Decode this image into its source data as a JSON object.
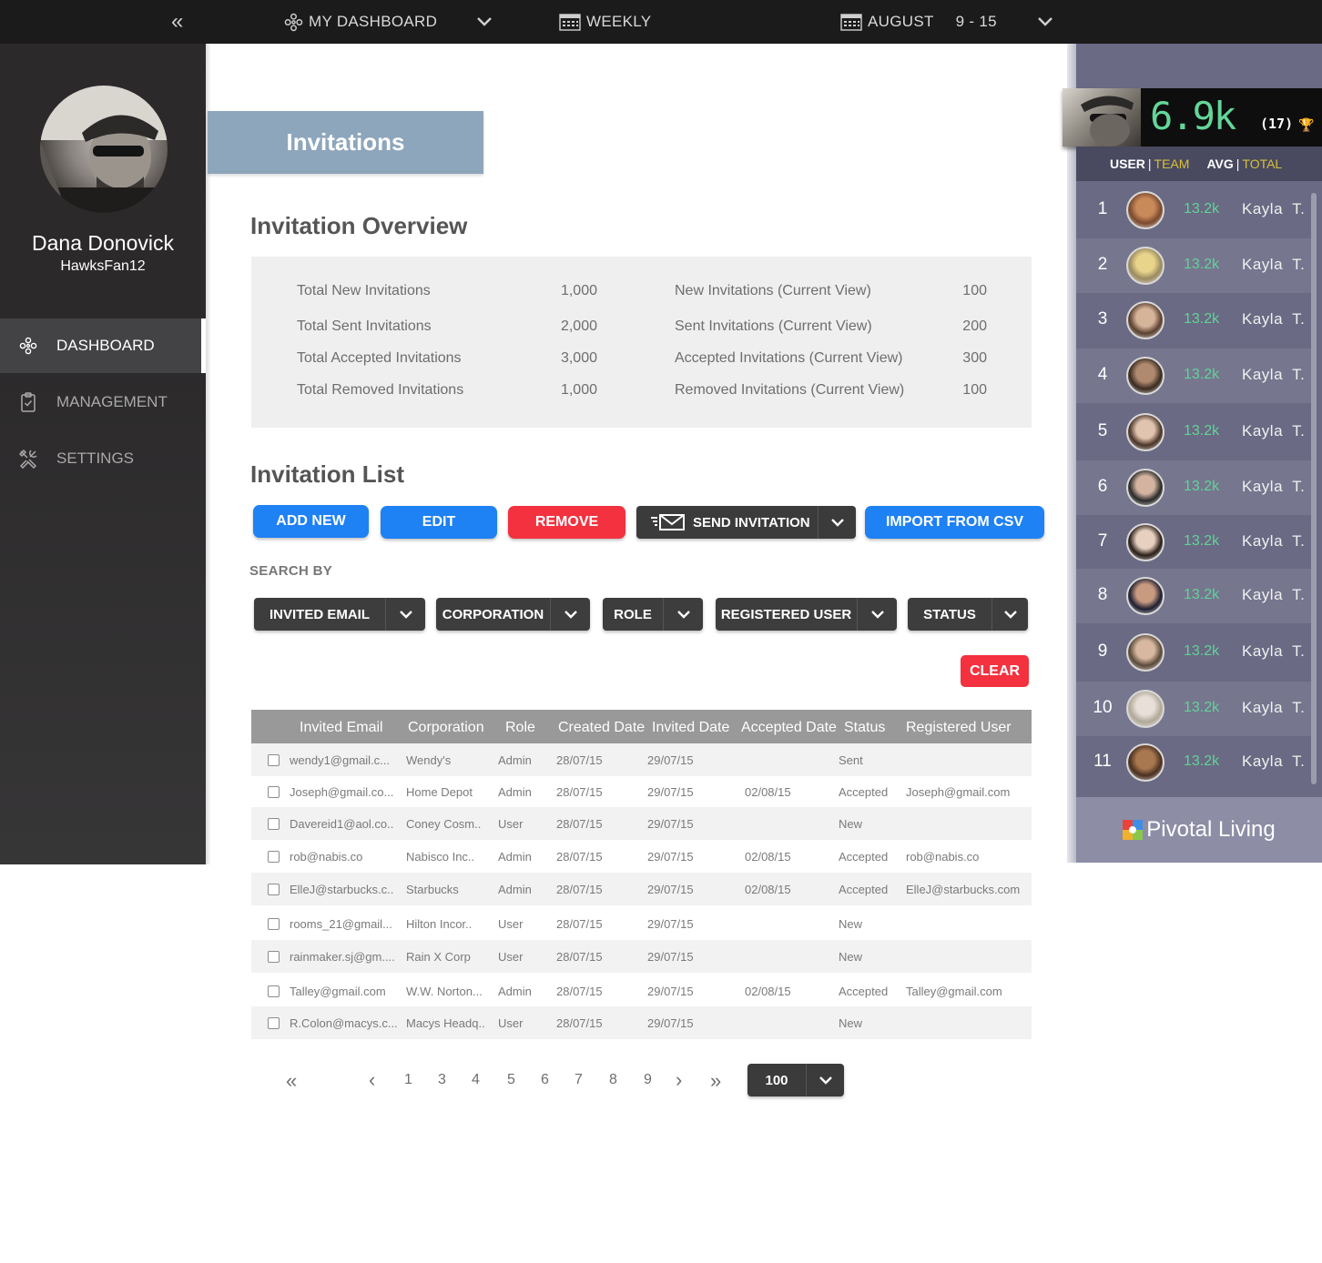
{
  "topbar": {
    "collapse_icon": "double-chevron-left-icon",
    "dashboard_label": "MY DASHBOARD",
    "weekly_label": "WEEKLY",
    "month_label": "AUGUST",
    "range_label": "9 - 15"
  },
  "sidebar": {
    "user_name": "Dana Donovick",
    "user_handle": "HawksFan12",
    "items": [
      {
        "label": "DASHBOARD",
        "icon": "dashboard-icon",
        "active": true
      },
      {
        "label": "MANAGEMENT",
        "icon": "clipboard-icon",
        "active": false
      },
      {
        "label": "SETTINGS",
        "icon": "tools-icon",
        "active": false
      }
    ]
  },
  "page": {
    "header": "Invitations",
    "overview_title": "Invitation Overview",
    "list_title": "Invitation List",
    "search_by_label": "SEARCH BY",
    "clear_label": "CLEAR"
  },
  "overview": {
    "left": [
      {
        "label": "Total New Invitations",
        "value": "1,000"
      },
      {
        "label": "Total Sent Invitations",
        "value": "2,000"
      },
      {
        "label": "Total Accepted Invitations",
        "value": "3,000"
      },
      {
        "label": "Total Removed Invitations",
        "value": "1,000"
      }
    ],
    "right": [
      {
        "label": "New Invitations (Current View)",
        "value": "100"
      },
      {
        "label": "Sent Invitations (Current View)",
        "value": "200"
      },
      {
        "label": "Accepted Invitations (Current View)",
        "value": "300"
      },
      {
        "label": "Removed Invitations (Current View)",
        "value": "100"
      }
    ]
  },
  "actions": {
    "add_new": "ADD NEW",
    "edit": "EDIT",
    "remove": "REMOVE",
    "send_invitation": "SEND INVITATION",
    "import_csv": "IMPORT FROM CSV"
  },
  "filters": [
    "INVITED EMAIL",
    "CORPORATION",
    "ROLE",
    "REGISTERED USER",
    "STATUS"
  ],
  "table": {
    "columns": [
      "Invited Email",
      "Corporation",
      "Role",
      "Created Date",
      "Invited Date",
      "Accepted Date",
      "Status",
      "Registered User"
    ],
    "rows": [
      [
        "wendy1@gmail.c...",
        "Wendy's",
        "Admin",
        "28/07/15",
        "29/07/15",
        "",
        "Sent",
        ""
      ],
      [
        "Joseph@gmail.co...",
        "Home Depot",
        "Admin",
        "28/07/15",
        "29/07/15",
        "02/08/15",
        "Accepted",
        "Joseph@gmail.com"
      ],
      [
        "Davereid1@aol.co..",
        "Coney Cosm..",
        "User",
        "28/07/15",
        "29/07/15",
        "",
        "New",
        ""
      ],
      [
        "rob@nabis.co",
        "Nabisco Inc..",
        "Admin",
        "28/07/15",
        "29/07/15",
        "02/08/15",
        "Accepted",
        "rob@nabis.co"
      ],
      [
        "ElleJ@starbucks.c..",
        "Starbucks",
        "Admin",
        "28/07/15",
        "29/07/15",
        "02/08/15",
        "Accepted",
        "ElleJ@starbucks.com"
      ],
      [
        "rooms_21@gmail...",
        "Hilton Incor..",
        "User",
        "28/07/15",
        "29/07/15",
        "",
        "New",
        ""
      ],
      [
        "rainmaker.sj@gm....",
        "Rain X Corp",
        "User",
        "28/07/15",
        "29/07/15",
        "",
        "New",
        ""
      ],
      [
        "Talley@gmail.com",
        "W.W. Norton...",
        "Admin",
        "28/07/15",
        "29/07/15",
        "02/08/15",
        "Accepted",
        "Talley@gmail.com"
      ],
      [
        "R.Colon@macys.c...",
        "Macys Headq..",
        "User",
        "28/07/15",
        "29/07/15",
        "",
        "New",
        ""
      ]
    ]
  },
  "pagination": {
    "first_icon": "double-chevron-left-icon",
    "prev_icon": "chevron-left-icon",
    "pages": [
      "1",
      "3",
      "4",
      "5",
      "6",
      "7",
      "8",
      "9"
    ],
    "next_icon": "chevron-right-icon",
    "last_icon": "double-chevron-right-icon",
    "per_page": "100"
  },
  "leaderboard": {
    "score": "6.9k",
    "count": "(17)",
    "toggle": {
      "user": "USER",
      "team": "TEAM",
      "avg": "AVG",
      "total": "TOTAL"
    },
    "rows": [
      {
        "rank": "1",
        "score": "13.2k",
        "name": "Kayla  T."
      },
      {
        "rank": "2",
        "score": "13.2k",
        "name": "Kayla  T."
      },
      {
        "rank": "3",
        "score": "13.2k",
        "name": "Kayla  T."
      },
      {
        "rank": "4",
        "score": "13.2k",
        "name": "Kayla  T."
      },
      {
        "rank": "5",
        "score": "13.2k",
        "name": "Kayla  T."
      },
      {
        "rank": "6",
        "score": "13.2k",
        "name": "Kayla  T."
      },
      {
        "rank": "7",
        "score": "13.2k",
        "name": "Kayla  T."
      },
      {
        "rank": "8",
        "score": "13.2k",
        "name": "Kayla  T."
      },
      {
        "rank": "9",
        "score": "13.2k",
        "name": "Kayla  T."
      },
      {
        "rank": "10",
        "score": "13.2k",
        "name": "Kayla  T."
      },
      {
        "rank": "11",
        "score": "13.2k",
        "name": "Kayla  T."
      }
    ],
    "brand": "Pivotal Living"
  },
  "colors": {
    "accent_blue": "#1e81f4",
    "danger_red": "#f3313f",
    "header_tab": "#8ea6bc",
    "score_green": "#63d69a",
    "team_yellow": "#d8c03a"
  }
}
